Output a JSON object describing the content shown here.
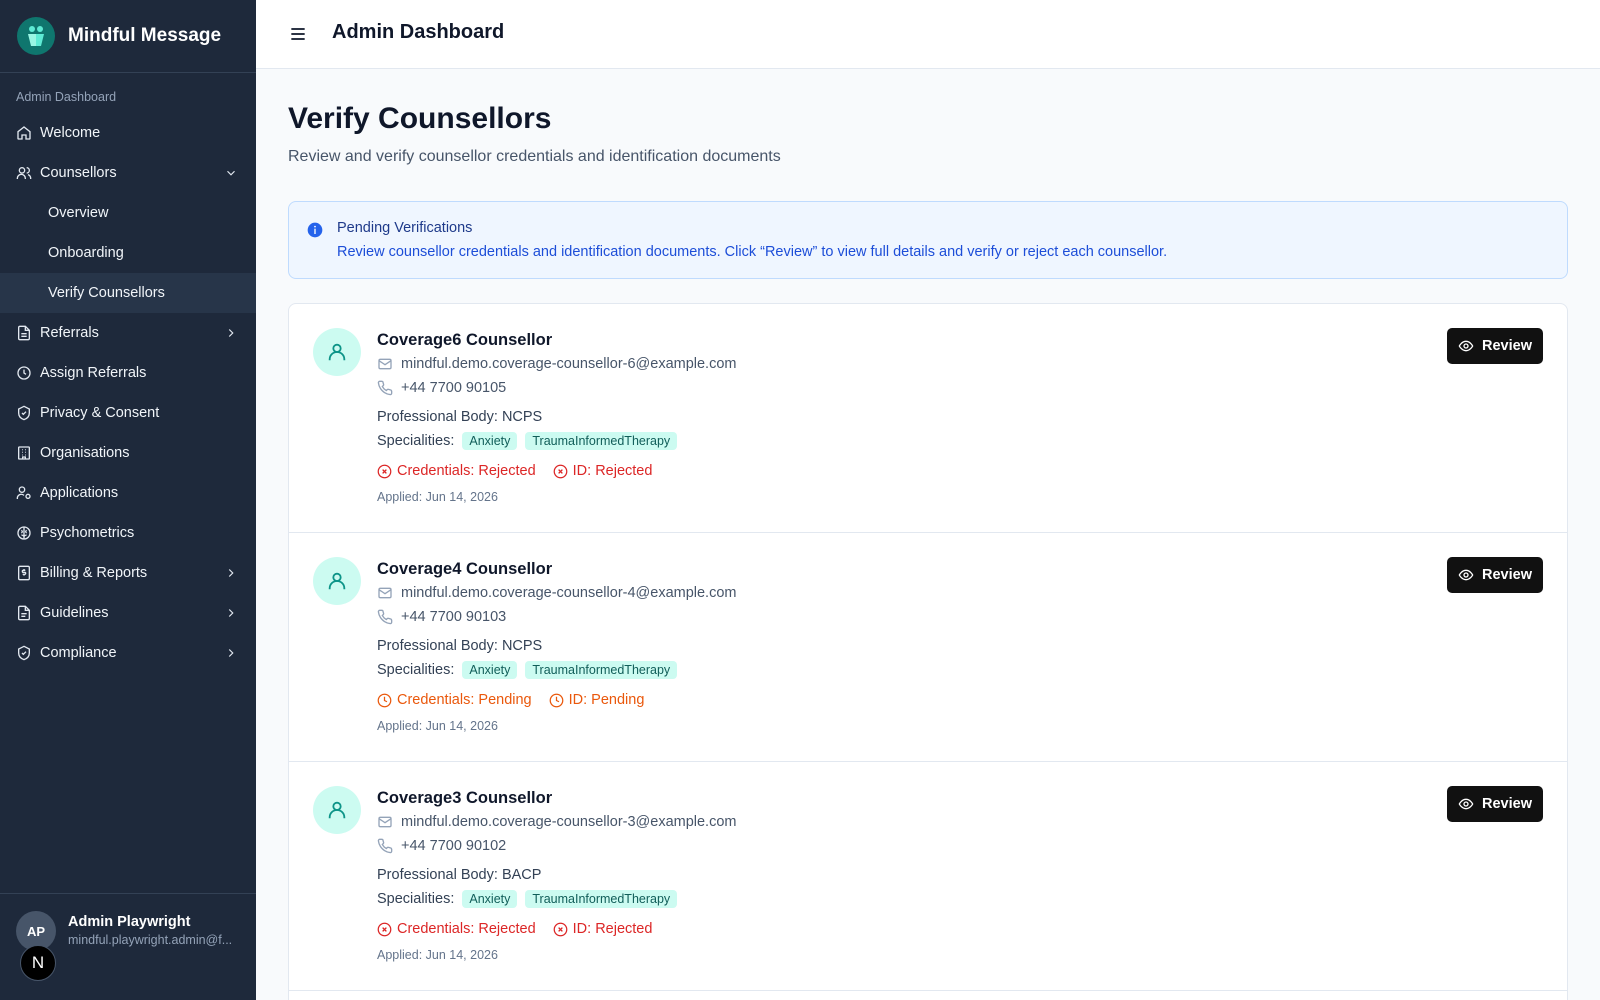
{
  "brand": {
    "name": "Mindful Message"
  },
  "sidebar": {
    "section_label": "Admin Dashboard",
    "items": [
      {
        "label": "Welcome",
        "icon": "home-icon"
      },
      {
        "label": "Counsellors",
        "icon": "users-icon",
        "expanded": true,
        "children": [
          {
            "label": "Overview"
          },
          {
            "label": "Onboarding"
          },
          {
            "label": "Verify Counsellors",
            "active": true
          }
        ]
      },
      {
        "label": "Referrals",
        "icon": "file-text-icon"
      },
      {
        "label": "Assign Referrals",
        "icon": "clock-icon"
      },
      {
        "label": "Privacy & Consent",
        "icon": "shield-check-icon"
      },
      {
        "label": "Organisations",
        "icon": "building-icon"
      },
      {
        "label": "Applications",
        "icon": "user-cog-icon"
      },
      {
        "label": "Psychometrics",
        "icon": "brain-icon"
      },
      {
        "label": "Billing & Reports",
        "icon": "receipt-icon"
      },
      {
        "label": "Guidelines",
        "icon": "file-icon"
      },
      {
        "label": "Compliance",
        "icon": "shield-icon"
      }
    ]
  },
  "user": {
    "initials": "AP",
    "name": "Admin Playwright",
    "email": "mindful.playwright.admin@f..."
  },
  "next_badge": "N",
  "topbar": {
    "title": "Admin Dashboard"
  },
  "page": {
    "title": "Verify Counsellors",
    "subtitle": "Review and verify counsellor credentials and identification documents"
  },
  "info": {
    "title": "Pending Verifications",
    "text": "Review counsellor credentials and identification documents. Click “Review” to view full details and verify or reject each counsellor."
  },
  "labels": {
    "professional_body": "Professional Body:",
    "specialities": "Specialities:",
    "review": "Review"
  },
  "counsellors": [
    {
      "name": "Coverage6 Counsellor",
      "email": "mindful.demo.coverage-counsellor-6@example.com",
      "phone": "+44 7700 90105",
      "professional_body": "NCPS",
      "specialities": [
        "Anxiety",
        "TraumaInformedTherapy"
      ],
      "credentials_status": "Credentials: Rejected",
      "id_status": "ID: Rejected",
      "status_kind": "rejected",
      "applied": "Applied: Jun 14, 2026"
    },
    {
      "name": "Coverage4 Counsellor",
      "email": "mindful.demo.coverage-counsellor-4@example.com",
      "phone": "+44 7700 90103",
      "professional_body": "NCPS",
      "specialities": [
        "Anxiety",
        "TraumaInformedTherapy"
      ],
      "credentials_status": "Credentials: Pending",
      "id_status": "ID: Pending",
      "status_kind": "pending",
      "applied": "Applied: Jun 14, 2026"
    },
    {
      "name": "Coverage3 Counsellor",
      "email": "mindful.demo.coverage-counsellor-3@example.com",
      "phone": "+44 7700 90102",
      "professional_body": "BACP",
      "specialities": [
        "Anxiety",
        "TraumaInformedTherapy"
      ],
      "credentials_status": "Credentials: Rejected",
      "id_status": "ID: Rejected",
      "status_kind": "rejected",
      "applied": "Applied: Jun 14, 2026"
    }
  ],
  "colors": {
    "sidebar_bg": "#1e293b",
    "accent_teal": "#14b8a6",
    "rejected": "#dc2626",
    "pending": "#ea580c",
    "info_bg": "#eff6ff"
  }
}
